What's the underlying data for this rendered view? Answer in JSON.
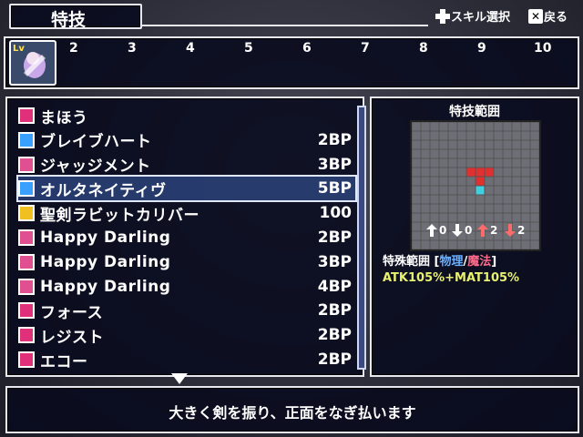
{
  "title": "特技",
  "hints": {
    "skill_select": "スキル選択",
    "back": "戻る"
  },
  "party": {
    "slots": [
      "2",
      "3",
      "4",
      "5",
      "6",
      "7",
      "8",
      "9",
      "10"
    ],
    "active_tag": "Lv"
  },
  "skills": [
    {
      "name": "まほう",
      "cost": "",
      "icon_color": "#e0307a"
    },
    {
      "name": "ブレイブハート",
      "cost": "2BP",
      "icon_color": "#3aa0ff"
    },
    {
      "name": "ジャッジメント",
      "cost": "3BP",
      "icon_color": "#e05090"
    },
    {
      "name": "オルタネイティヴ",
      "cost": "5BP",
      "icon_color": "#3aa0ff",
      "selected": true
    },
    {
      "name": "聖剣ラビットカリバー",
      "cost": "100",
      "icon_color": "#f0c020"
    },
    {
      "name": "Happy Darling",
      "cost": "2BP",
      "icon_color": "#e05090"
    },
    {
      "name": "Happy Darling",
      "cost": "3BP",
      "icon_color": "#e05090"
    },
    {
      "name": "Happy Darling",
      "cost": "4BP",
      "icon_color": "#e05090"
    },
    {
      "name": "フォース",
      "cost": "2BP",
      "icon_color": "#e0307a"
    },
    {
      "name": "レジスト",
      "cost": "2BP",
      "icon_color": "#e0307a"
    },
    {
      "name": "エコー",
      "cost": "2BP",
      "icon_color": "#e0307a"
    }
  ],
  "range": {
    "title": "特技範囲",
    "stats": [
      "0",
      "0",
      "2",
      "2"
    ],
    "special_label": "特殊範囲",
    "physical": "物理",
    "magic": "魔法",
    "atk_line": "ATK105%+MAT105%"
  },
  "description": "大きく剣を振り、正面をなぎ払います"
}
